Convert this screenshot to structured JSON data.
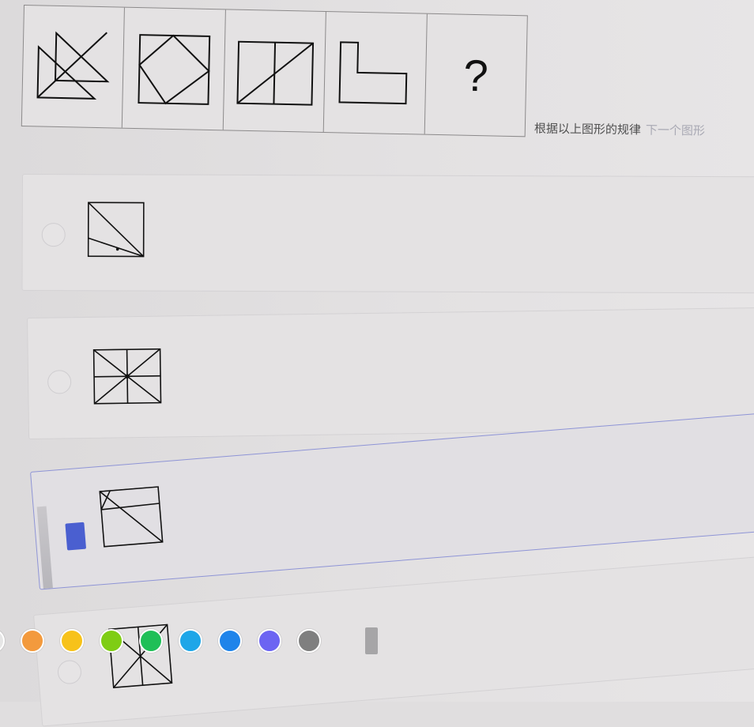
{
  "question": {
    "cells": [
      {
        "figure": "two-overlapping-triangles"
      },
      {
        "figure": "square-with-inscribed-diamond"
      },
      {
        "figure": "rectangle-split-with-diagonal"
      },
      {
        "figure": "l-shape"
      },
      {
        "figure": "question-mark",
        "text": "?"
      }
    ],
    "prompt": "根据以上图形的规律",
    "prompt_faded": "下一个图形"
  },
  "options": [
    {
      "id": "a",
      "figure": "square-with-diagonal-and-chord",
      "selected": false
    },
    {
      "id": "b",
      "figure": "rectangle-eight-way-split",
      "selected": false
    },
    {
      "id": "c",
      "figure": "square-with-three-lines",
      "selected": true
    },
    {
      "id": "d",
      "figure": "square-with-x-and-midline",
      "selected": false
    }
  ],
  "palette": {
    "colors": [
      "#e6e6e6",
      "#f39a3d",
      "#f7c21a",
      "#7fcd14",
      "#1fbf57",
      "#1ea6e8",
      "#1f84ea",
      "#6c64f2",
      "#7f7f7f"
    ],
    "selected_accent": "#4a5fd0"
  }
}
